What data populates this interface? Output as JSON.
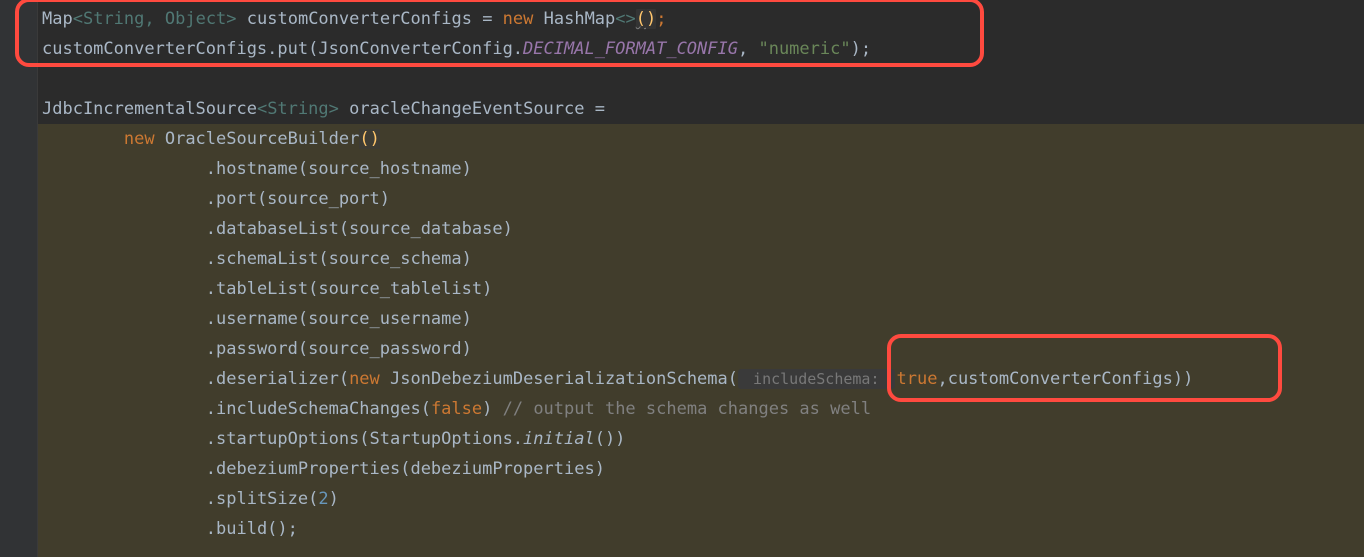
{
  "code": {
    "line1": {
      "t1": "Map",
      "t2": "<",
      "t3": "String",
      "t4": ", ",
      "t5": "Object",
      "t6": ">",
      "t7": " customConverterConfigs ",
      "t8": "= ",
      "t9": "new ",
      "t10": "HashMap",
      "t11": "<>",
      "t12": "(",
      "t13": ")",
      "t14": ";"
    },
    "line2": {
      "t1": "customConverterConfigs.put(JsonConverterConfig.",
      "t2": "DECIMAL_FORMAT_CONFIG",
      "t3": ", ",
      "t4": "\"numeric\"",
      "t5": ");"
    },
    "line4": {
      "t1": "JdbcIncrementalSource",
      "t2": "<",
      "t3": "String",
      "t4": ">",
      "t5": " oracleChangeEventSource ="
    },
    "line5": {
      "indent": "        ",
      "t1": "new ",
      "t2": "OracleSourceBuilder",
      "t3": "(",
      "t4": ")"
    },
    "line6": {
      "indent": "                ",
      "t1": ".hostname(source_hostname)"
    },
    "line7": {
      "indent": "                ",
      "t1": ".port(source_port)"
    },
    "line8": {
      "indent": "                ",
      "t1": ".databaseList(source_database)"
    },
    "line9": {
      "indent": "                ",
      "t1": ".schemaList(source_schema)"
    },
    "line10": {
      "indent": "                ",
      "t1": ".tableList(source_tablelist)"
    },
    "line11": {
      "indent": "                ",
      "t1": ".username(source_username)"
    },
    "line12": {
      "indent": "                ",
      "t1": ".password(source_password)"
    },
    "line13": {
      "indent": "                ",
      "t1": ".deserializer(",
      "t2": "new ",
      "t3": "JsonDebeziumDeserializationSchema(",
      "hint": " includeSchema: ",
      "t4": "true",
      "t5": ",customConverterConfigs))"
    },
    "line14": {
      "indent": "                ",
      "t1": ".includeSchemaChanges(",
      "t2": "false",
      "t3": ") ",
      "t4": "// output the schema changes as well"
    },
    "line15": {
      "indent": "                ",
      "t1": ".startupOptions(StartupOptions.",
      "t2": "initial",
      "t3": "())"
    },
    "line16": {
      "indent": "                ",
      "t1": ".debeziumProperties(debeziumProperties)"
    },
    "line17": {
      "indent": "                ",
      "t1": ".splitSize(",
      "t2": "2",
      "t3": ")"
    },
    "line18": {
      "indent": "                ",
      "t1": ".build();"
    }
  }
}
